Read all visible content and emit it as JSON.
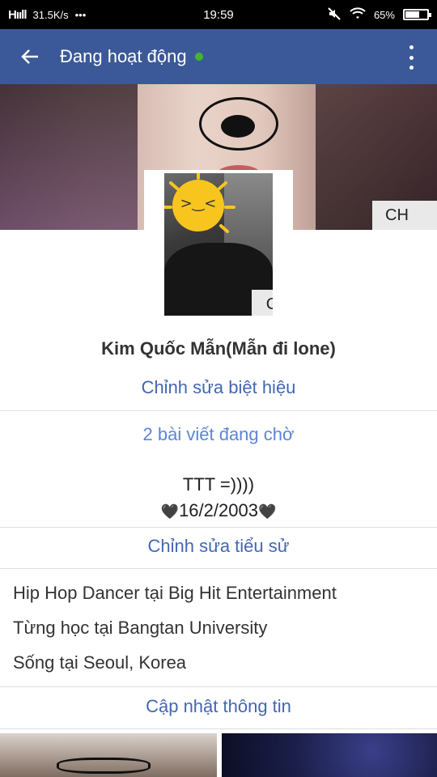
{
  "status_bar": {
    "signal": "Hııll",
    "net_speed": "31.5K/s",
    "dots": "•••",
    "time": "19:59",
    "battery_percent": "65%",
    "battery_level": 0.65
  },
  "app_bar": {
    "title": "Đang hoạt động",
    "online_color": "#42b72a",
    "bar_color": "#3b5998"
  },
  "cover": {
    "badge_text": "CH"
  },
  "avatar": {
    "badge_text": "C"
  },
  "profile": {
    "name": "Kim Quốc Mẫn(Mẫn đi lone)",
    "edit_nickname": "Chỉnh sửa biệt hiệu",
    "pending_posts": "2 bài viết đang chờ",
    "bio_line1": "TTT =))))",
    "bio_date": "16/2/2003",
    "heart_icon": "🖤",
    "edit_bio": "Chỉnh sửa tiểu sử"
  },
  "info": [
    "Hip Hop Dancer tại Big Hit Entertainment",
    "Từng học tại Bangtan University",
    "Sống tại Seoul, Korea"
  ],
  "update_info": "Cập nhật thông tin",
  "colors": {
    "link": "#4267b2",
    "pending": "#5b86d6"
  }
}
